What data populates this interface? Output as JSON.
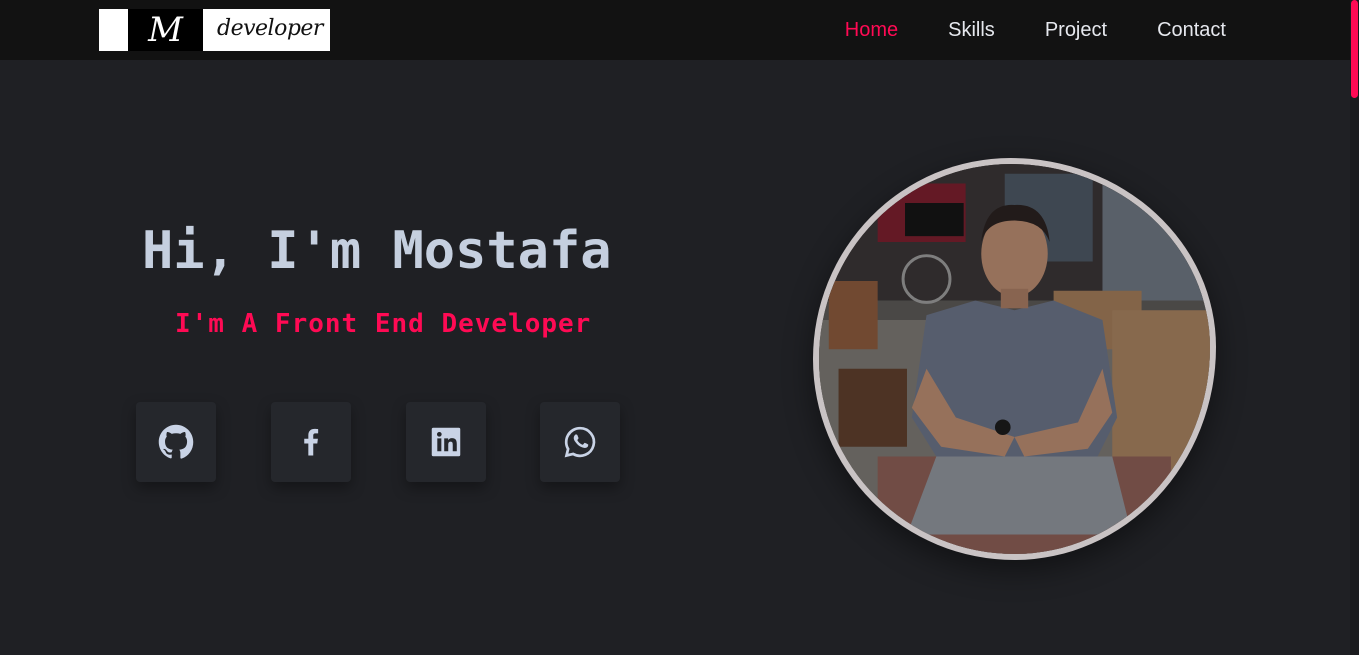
{
  "navbar": {
    "logo": {
      "mark": "M",
      "text": "developer"
    },
    "links": [
      {
        "label": "Home",
        "active": true
      },
      {
        "label": "Skills",
        "active": false
      },
      {
        "label": "Project",
        "active": false
      },
      {
        "label": "Contact",
        "active": false
      }
    ]
  },
  "hero": {
    "title": "Hi, I'm Mostafa",
    "subtitle": "I'm A Front End Developer"
  },
  "socials": [
    {
      "icon": "github-icon"
    },
    {
      "icon": "facebook-icon"
    },
    {
      "icon": "linkedin-icon"
    },
    {
      "icon": "whatsapp-icon"
    }
  ],
  "profile_photo": {
    "description_icon": "profile-photo"
  },
  "colors": {
    "accent": "#ff0a54",
    "background": "#1f2024",
    "navbar": "#121212",
    "heading": "#c5cfdf",
    "tile": "#25272c"
  }
}
